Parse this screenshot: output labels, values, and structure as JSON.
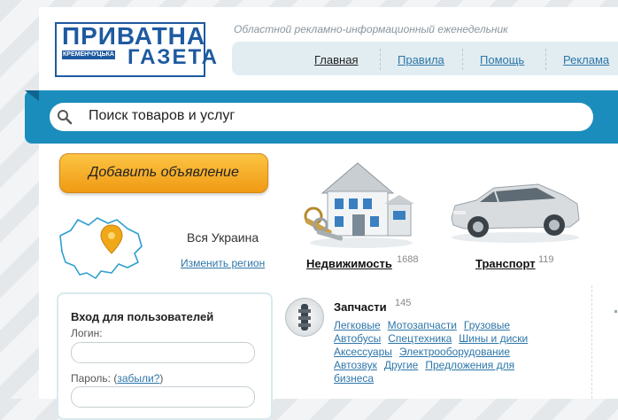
{
  "logo": {
    "top": "ПРИВАТНА",
    "strip": "КРЕМЕНЧУЦЬКА",
    "bottom": "ГАЗЕТА"
  },
  "tagline": "Областной рекламно-информационный еженедельник",
  "nav": [
    {
      "label": "Главная",
      "active": true
    },
    {
      "label": "Правила",
      "active": false
    },
    {
      "label": "Помощь",
      "active": false
    },
    {
      "label": "Реклама",
      "active": false
    }
  ],
  "search": {
    "placeholder": "Поиск товаров и услуг",
    "icon": "search-icon"
  },
  "add_button": {
    "label": "Добавить объявление"
  },
  "region": {
    "name": "Вся Украина",
    "change_link": "Изменить регион"
  },
  "categories": [
    {
      "title": "Недвижимость",
      "count": "1688",
      "icon": "house-icon"
    },
    {
      "title": "Транспорт",
      "count": "119",
      "icon": "car-icon"
    }
  ],
  "login": {
    "title": "Вход для пользователей",
    "login_label": "Логин:",
    "password_label": "Пароль:",
    "forgot_prefix": "(",
    "forgot_link": "забыли?",
    "forgot_suffix": ")"
  },
  "parts": {
    "title": "Запчасти",
    "count": "145",
    "links": [
      "Легковые",
      "Мотозапчасти",
      "Грузовые",
      "Автобусы",
      "Спецтехника",
      "Шины и диски",
      "Аксессуары",
      "Электрооборудование",
      "Автозвук",
      "Другие",
      "Предложения для бизнеса"
    ]
  },
  "colors": {
    "accent": "#1b8dbc",
    "link": "#2d76a9",
    "button": "#f5a623"
  }
}
